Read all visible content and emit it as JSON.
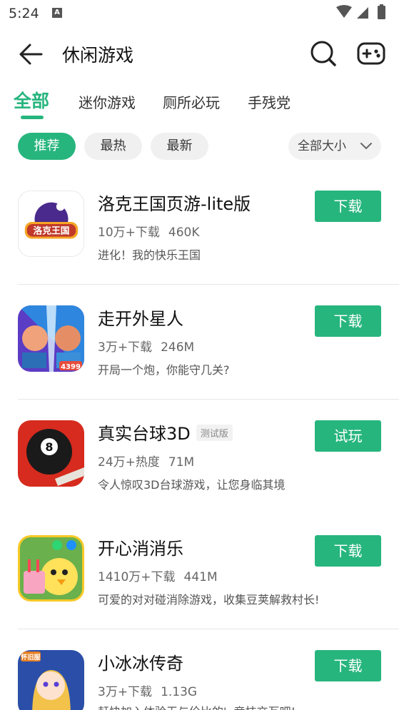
{
  "status_bar": {
    "time": "5:24",
    "notif_glyph": "A"
  },
  "header": {
    "title": "休闲游戏",
    "back_icon": "arrow-left-icon",
    "search_icon": "search-icon",
    "game_icon": "gamepad-icon"
  },
  "tabs": [
    {
      "label": "全部",
      "active": true
    },
    {
      "label": "迷你游戏"
    },
    {
      "label": "厕所必玩"
    },
    {
      "label": "手残党"
    }
  ],
  "filters": {
    "chips": [
      {
        "label": "推荐",
        "active": true
      },
      {
        "label": "最热"
      },
      {
        "label": "最新"
      }
    ],
    "size_select": "全部大小"
  },
  "accent_color": "#27b57e",
  "games": [
    {
      "name": "洛克王国页游-lite版",
      "downloads": "10万+下载",
      "size": "460K",
      "desc": "进化！我的快乐王国",
      "action": "下载",
      "icon_text": "洛克王国",
      "icon": "roco-kingdom-icon"
    },
    {
      "name": "走开外星人",
      "downloads": "3万+下载",
      "size": "246M",
      "desc": "开局一个炮，你能守几关?",
      "action": "下载",
      "icon_text": "4399",
      "icon": "aliens-game-icon"
    },
    {
      "name": "真实台球3D",
      "tag": "测试版",
      "downloads": "24万+热度",
      "size": "71M",
      "desc": "令人惊叹3D台球游戏，让您身临其境",
      "action": "试玩",
      "icon_text": "8",
      "icon": "billiard-ball-icon"
    },
    {
      "name": "开心消消乐",
      "downloads": "1410万+下载",
      "size": "441M",
      "desc": "可爱的对对碰消除游戏，收集豆荚解救村长!",
      "action": "下载",
      "icon_text": "",
      "icon": "happy-match-icon"
    },
    {
      "name": "小冰冰传奇",
      "downloads": "3万+下载",
      "size": "1.13G",
      "desc": "赶快加入体验无与伦比的', 竞技交互吧!",
      "action": "下载",
      "icon_text": "怀旧服",
      "icon": "ice-legend-icon"
    }
  ]
}
